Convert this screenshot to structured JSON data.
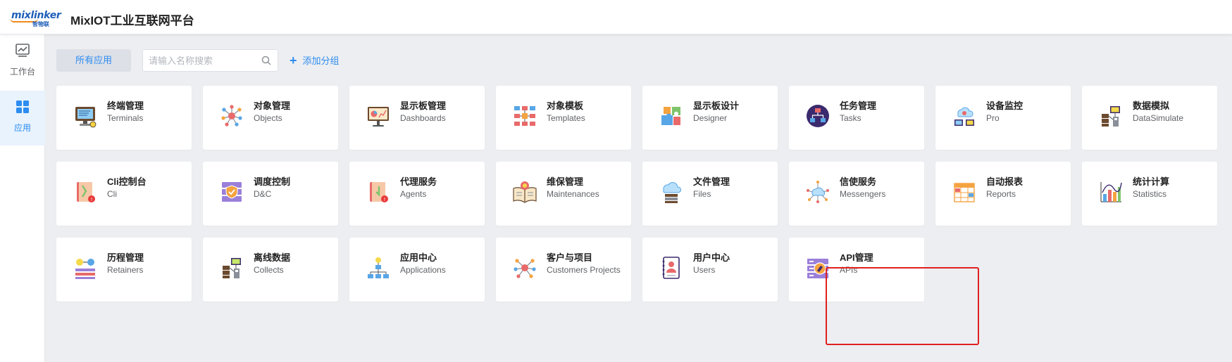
{
  "app": {
    "logo_text": "mixlinker",
    "logo_sub": "智物联",
    "title": "MixIOT工业互联网平台"
  },
  "sidebar": {
    "items": [
      {
        "label": "工作台",
        "icon": "chart-line-icon",
        "active": false
      },
      {
        "label": "应用",
        "icon": "grid-apps-icon",
        "active": true
      }
    ]
  },
  "toolbar": {
    "all_apps_label": "所有应用",
    "search_placeholder": "请输入名称搜索",
    "search_value": "",
    "add_group_label": "添加分组"
  },
  "apps": [
    {
      "title": "终端管理",
      "subtitle": "Terminals",
      "icon": "terminal-icon"
    },
    {
      "title": "对象管理",
      "subtitle": "Objects",
      "icon": "objects-network-icon"
    },
    {
      "title": "显示板管理",
      "subtitle": "Dashboards",
      "icon": "dashboard-board-icon"
    },
    {
      "title": "对象模板",
      "subtitle": "Templates",
      "icon": "templates-icon"
    },
    {
      "title": "显示板设计",
      "subtitle": "Designer",
      "icon": "puzzle-icon"
    },
    {
      "title": "任务管理",
      "subtitle": "Tasks",
      "icon": "tasks-hierarchy-icon"
    },
    {
      "title": "设备监控",
      "subtitle": "Pro",
      "icon": "cloud-monitor-icon"
    },
    {
      "title": "数据模拟",
      "subtitle": "DataSimulate",
      "icon": "data-simulate-icon"
    },
    {
      "title": "Cli控制台",
      "subtitle": "Cli",
      "icon": "cli-book-icon"
    },
    {
      "title": "调度控制",
      "subtitle": "D&C",
      "icon": "server-shield-icon"
    },
    {
      "title": "代理服务",
      "subtitle": "Agents",
      "icon": "agents-book-icon"
    },
    {
      "title": "维保管理",
      "subtitle": "Maintenances",
      "icon": "maintenance-book-icon"
    },
    {
      "title": "文件管理",
      "subtitle": "Files",
      "icon": "cloud-files-icon"
    },
    {
      "title": "信使服务",
      "subtitle": "Messengers",
      "icon": "cloud-network-icon"
    },
    {
      "title": "自动报表",
      "subtitle": "Reports",
      "icon": "report-table-icon"
    },
    {
      "title": "统计计算",
      "subtitle": "Statistics",
      "icon": "statistics-chart-icon"
    },
    {
      "title": "历程管理",
      "subtitle": "Retainers",
      "icon": "retainers-icon"
    },
    {
      "title": "离线数据",
      "subtitle": "Collects",
      "icon": "offline-data-icon"
    },
    {
      "title": "应用中心",
      "subtitle": "Applications",
      "icon": "applications-tree-icon"
    },
    {
      "title": "客户与项目",
      "subtitle": "Customers Projects",
      "icon": "customers-network-icon"
    },
    {
      "title": "用户中心",
      "subtitle": "Users",
      "icon": "user-profile-icon"
    },
    {
      "title": "API管理",
      "subtitle": "APIs",
      "icon": "api-server-icon"
    }
  ],
  "colors": {
    "accent": "#2d8cf0",
    "highlight_border": "#e02020",
    "background": "#edeef1"
  }
}
